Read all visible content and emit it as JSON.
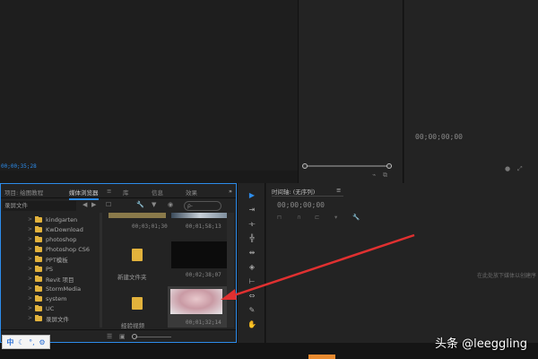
{
  "source_monitor": {
    "timecode": "00;00;35;28"
  },
  "program_monitor": {
    "timecode": "00;00;00;00"
  },
  "media_browser": {
    "tabs": [
      {
        "label": "项目: 绘图教程"
      },
      {
        "label": "媒体浏览器"
      },
      {
        "label": "库"
      },
      {
        "label": "信息"
      },
      {
        "label": "效果"
      }
    ],
    "tab_menu_glyph": "≡",
    "folder_select": "录屏文件",
    "search_placeholder": "ρ-",
    "tree_items": [
      "kindgarten",
      "KwDownload",
      "photoshop",
      "Photoshop CS6",
      "PPT模板",
      "PS",
      "Revit 项目",
      "StormMedia",
      "system",
      "UC",
      "录屏文件"
    ],
    "thumbs": [
      {
        "label": "",
        "duration": "00;03;01;30"
      },
      {
        "label": "",
        "duration": "00;01;58;13"
      },
      {
        "label": "新建文件夹",
        "duration": ""
      },
      {
        "label": "",
        "duration": "00;02;38;07"
      },
      {
        "label": "经验视频",
        "duration": ""
      },
      {
        "label": "",
        "duration": "00;01;32;14"
      }
    ]
  },
  "timeline": {
    "title": "时间轴: (无序列)",
    "timecode": "00;00;00;00",
    "drop_hint": "在此处放下媒体以创建序"
  },
  "tools": [
    {
      "name": "selection-tool",
      "glyph": "▶"
    },
    {
      "name": "track-select-tool",
      "glyph": "⇥"
    },
    {
      "name": "ripple-edit-tool",
      "glyph": "⟛"
    },
    {
      "name": "rolling-edit-tool",
      "glyph": "╬"
    },
    {
      "name": "rate-stretch-tool",
      "glyph": "⇹"
    },
    {
      "name": "razor-tool",
      "glyph": "◈"
    },
    {
      "name": "slip-tool",
      "glyph": "⊢"
    },
    {
      "name": "slide-tool",
      "glyph": "⇔"
    },
    {
      "name": "pen-tool",
      "glyph": "✎"
    },
    {
      "name": "hand-tool",
      "glyph": "✋"
    }
  ],
  "ime": {
    "lang": "中",
    "moon": "☾",
    "dots": "°,",
    "gear": "⚙"
  },
  "watermark": "头条 @leeggling",
  "colors": {
    "accent": "#2d8ceb",
    "folder": "#e2b23c",
    "arrow": "#e03030"
  }
}
